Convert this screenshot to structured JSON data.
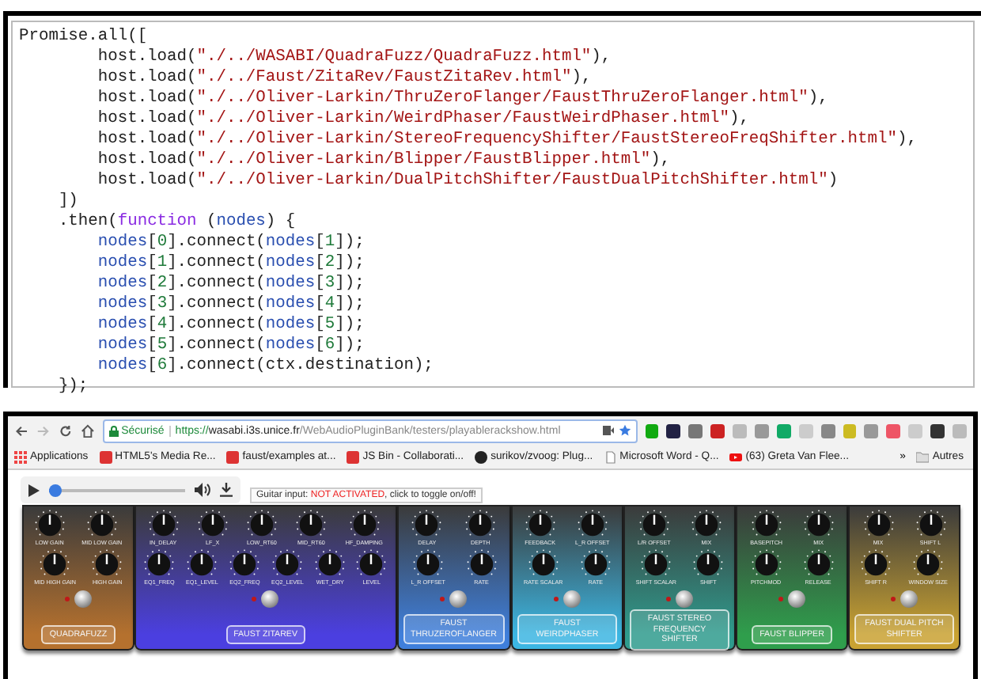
{
  "code": {
    "lines": [
      [
        {
          "kind": "plain",
          "text": "Promise.all(["
        }
      ],
      [
        {
          "kind": "plain",
          "text": "        host.load("
        },
        {
          "kind": "string",
          "text": "\"./../WASABI/QuadraFuzz/QuadraFuzz.html\""
        },
        {
          "kind": "plain",
          "text": "),"
        }
      ],
      [
        {
          "kind": "plain",
          "text": "        host.load("
        },
        {
          "kind": "string",
          "text": "\"./../Faust/ZitaRev/FaustZitaRev.html\""
        },
        {
          "kind": "plain",
          "text": "),"
        }
      ],
      [
        {
          "kind": "plain",
          "text": "        host.load("
        },
        {
          "kind": "string",
          "text": "\"./../Oliver-Larkin/ThruZeroFlanger/FaustThruZeroFlanger.html\""
        },
        {
          "kind": "plain",
          "text": "),"
        }
      ],
      [
        {
          "kind": "plain",
          "text": "        host.load("
        },
        {
          "kind": "string",
          "text": "\"./../Oliver-Larkin/WeirdPhaser/FaustWeirdPhaser.html\""
        },
        {
          "kind": "plain",
          "text": "),"
        }
      ],
      [
        {
          "kind": "plain",
          "text": "        host.load("
        },
        {
          "kind": "string",
          "text": "\"./../Oliver-Larkin/StereoFrequencyShifter/FaustStereoFreqShifter.html\""
        },
        {
          "kind": "plain",
          "text": "),"
        }
      ],
      [
        {
          "kind": "plain",
          "text": "        host.load("
        },
        {
          "kind": "string",
          "text": "\"./../Oliver-Larkin/Blipper/FaustBlipper.html\""
        },
        {
          "kind": "plain",
          "text": "),"
        }
      ],
      [
        {
          "kind": "plain",
          "text": "        host.load("
        },
        {
          "kind": "string",
          "text": "\"./../Oliver-Larkin/DualPitchShifter/FaustDualPitchShifter.html\""
        },
        {
          "kind": "plain",
          "text": ")"
        }
      ],
      [
        {
          "kind": "plain",
          "text": "    ])"
        }
      ],
      [
        {
          "kind": "plain",
          "text": "    .then("
        },
        {
          "kind": "keyword",
          "text": "function"
        },
        {
          "kind": "plain",
          "text": " ("
        },
        {
          "kind": "variable",
          "text": "nodes"
        },
        {
          "kind": "plain",
          "text": ") {"
        }
      ],
      [
        {
          "kind": "variable",
          "text": "        nodes"
        },
        {
          "kind": "plain",
          "text": "["
        },
        {
          "kind": "number",
          "text": "0"
        },
        {
          "kind": "plain",
          "text": "].connect("
        },
        {
          "kind": "variable",
          "text": "nodes"
        },
        {
          "kind": "plain",
          "text": "["
        },
        {
          "kind": "number",
          "text": "1"
        },
        {
          "kind": "plain",
          "text": "]);"
        }
      ],
      [
        {
          "kind": "variable",
          "text": "        nodes"
        },
        {
          "kind": "plain",
          "text": "["
        },
        {
          "kind": "number",
          "text": "1"
        },
        {
          "kind": "plain",
          "text": "].connect("
        },
        {
          "kind": "variable",
          "text": "nodes"
        },
        {
          "kind": "plain",
          "text": "["
        },
        {
          "kind": "number",
          "text": "2"
        },
        {
          "kind": "plain",
          "text": "]);"
        }
      ],
      [
        {
          "kind": "variable",
          "text": "        nodes"
        },
        {
          "kind": "plain",
          "text": "["
        },
        {
          "kind": "number",
          "text": "2"
        },
        {
          "kind": "plain",
          "text": "].connect("
        },
        {
          "kind": "variable",
          "text": "nodes"
        },
        {
          "kind": "plain",
          "text": "["
        },
        {
          "kind": "number",
          "text": "3"
        },
        {
          "kind": "plain",
          "text": "]);"
        }
      ],
      [
        {
          "kind": "variable",
          "text": "        nodes"
        },
        {
          "kind": "plain",
          "text": "["
        },
        {
          "kind": "number",
          "text": "3"
        },
        {
          "kind": "plain",
          "text": "].connect("
        },
        {
          "kind": "variable",
          "text": "nodes"
        },
        {
          "kind": "plain",
          "text": "["
        },
        {
          "kind": "number",
          "text": "4"
        },
        {
          "kind": "plain",
          "text": "]);"
        }
      ],
      [
        {
          "kind": "variable",
          "text": "        nodes"
        },
        {
          "kind": "plain",
          "text": "["
        },
        {
          "kind": "number",
          "text": "4"
        },
        {
          "kind": "plain",
          "text": "].connect("
        },
        {
          "kind": "variable",
          "text": "nodes"
        },
        {
          "kind": "plain",
          "text": "["
        },
        {
          "kind": "number",
          "text": "5"
        },
        {
          "kind": "plain",
          "text": "]);"
        }
      ],
      [
        {
          "kind": "variable",
          "text": "        nodes"
        },
        {
          "kind": "plain",
          "text": "["
        },
        {
          "kind": "number",
          "text": "5"
        },
        {
          "kind": "plain",
          "text": "].connect("
        },
        {
          "kind": "variable",
          "text": "nodes"
        },
        {
          "kind": "plain",
          "text": "["
        },
        {
          "kind": "number",
          "text": "6"
        },
        {
          "kind": "plain",
          "text": "]);"
        }
      ],
      [
        {
          "kind": "variable",
          "text": "        nodes"
        },
        {
          "kind": "plain",
          "text": "["
        },
        {
          "kind": "number",
          "text": "6"
        },
        {
          "kind": "plain",
          "text": "].connect(ctx.destination);"
        }
      ],
      [
        {
          "kind": "plain",
          "text": "    });"
        }
      ]
    ]
  },
  "browser": {
    "address_bar": {
      "secure_label": "Sécurisé",
      "scheme": "https://",
      "host": "wasabi.i3s.unice.fr",
      "path": "/WebAudioPluginBank/testers/playablerackshow.html"
    },
    "bookmarks": [
      {
        "label": "Applications",
        "kind": "apps"
      },
      {
        "label": "HTML5's Media Re...",
        "kind": "site"
      },
      {
        "label": "faust/examples at...",
        "kind": "site"
      },
      {
        "label": "JS Bin - Collaborati...",
        "kind": "site"
      },
      {
        "label": "surikov/zvoog: Plug...",
        "kind": "github"
      },
      {
        "label": "Microsoft Word - Q...",
        "kind": "page"
      },
      {
        "label": "(63) Greta Van Flee...",
        "kind": "video"
      }
    ],
    "bookmarks_more": "»",
    "other_bookmarks": "Autres",
    "player": {
      "level": 0.05
    },
    "guitar_input": {
      "prefix": "Guitar input: ",
      "status": "NOT ACTIVATED",
      "suffix": ", click to toggle on/off!"
    },
    "plugins": [
      {
        "name": "QUADRAFUZZ",
        "color": "#b5712e",
        "knobs": [
          [
            {
              "label": "LOW GAIN"
            },
            {
              "label": "MID LOW GAIN"
            }
          ],
          [
            {
              "label": "MID HIGH GAIN"
            },
            {
              "label": "HIGH GAIN"
            }
          ]
        ]
      },
      {
        "name": "FAUST ZITAREV",
        "color": "#4b3fe0",
        "knobs": [
          [
            {
              "label": "IN_DELAY"
            },
            {
              "label": "LF_X"
            },
            {
              "label": "LOW_RT60"
            },
            {
              "label": "MID_RT60"
            },
            {
              "label": "HF_DAMPING"
            }
          ],
          [
            {
              "label": "EQ1_FREQ"
            },
            {
              "label": "EQ1_LEVEL"
            },
            {
              "label": "EQ2_FREQ"
            },
            {
              "label": "EQ2_LEVEL"
            },
            {
              "label": "WET_DRY"
            },
            {
              "label": "LEVEL"
            }
          ]
        ]
      },
      {
        "name": "FAUST THRUZEROFLANGER",
        "color": "#3f7fdb",
        "knobs": [
          [
            {
              "label": "DELAY"
            },
            {
              "label": "DEPTH"
            }
          ],
          [
            {
              "label": "L_R OFFSET"
            },
            {
              "label": "RATE"
            }
          ]
        ]
      },
      {
        "name": "FAUST WEIRDPHASER",
        "color": "#3cb6e2",
        "knobs": [
          [
            {
              "label": "FEEDBACK"
            },
            {
              "label": "L_R OFFSET"
            }
          ],
          [
            {
              "label": "RATE SCALAR"
            },
            {
              "label": "RATE"
            }
          ]
        ]
      },
      {
        "name": "FAUST STEREO FREQUENCY SHIFTER",
        "color": "#2f9c8e",
        "knobs": [
          [
            {
              "label": "L/R OFFSET"
            },
            {
              "label": "MIX"
            }
          ],
          [
            {
              "label": "SHIFT SCALAR"
            },
            {
              "label": "SHIFT"
            }
          ]
        ]
      },
      {
        "name": "FAUST BLIPPER",
        "color": "#2f9e4c",
        "knobs": [
          [
            {
              "label": "BASEPITCH"
            },
            {
              "label": "MIX"
            }
          ],
          [
            {
              "label": "PITCHMOD"
            },
            {
              "label": "RELEASE"
            }
          ]
        ]
      },
      {
        "name": "FAUST DUAL PITCH SHIFTER",
        "color": "#c9a232",
        "knobs": [
          [
            {
              "label": "MIX"
            },
            {
              "label": "SHIFT L"
            }
          ],
          [
            {
              "label": "SHIFT R"
            },
            {
              "label": "WINDOW SIZE"
            }
          ]
        ]
      }
    ]
  }
}
